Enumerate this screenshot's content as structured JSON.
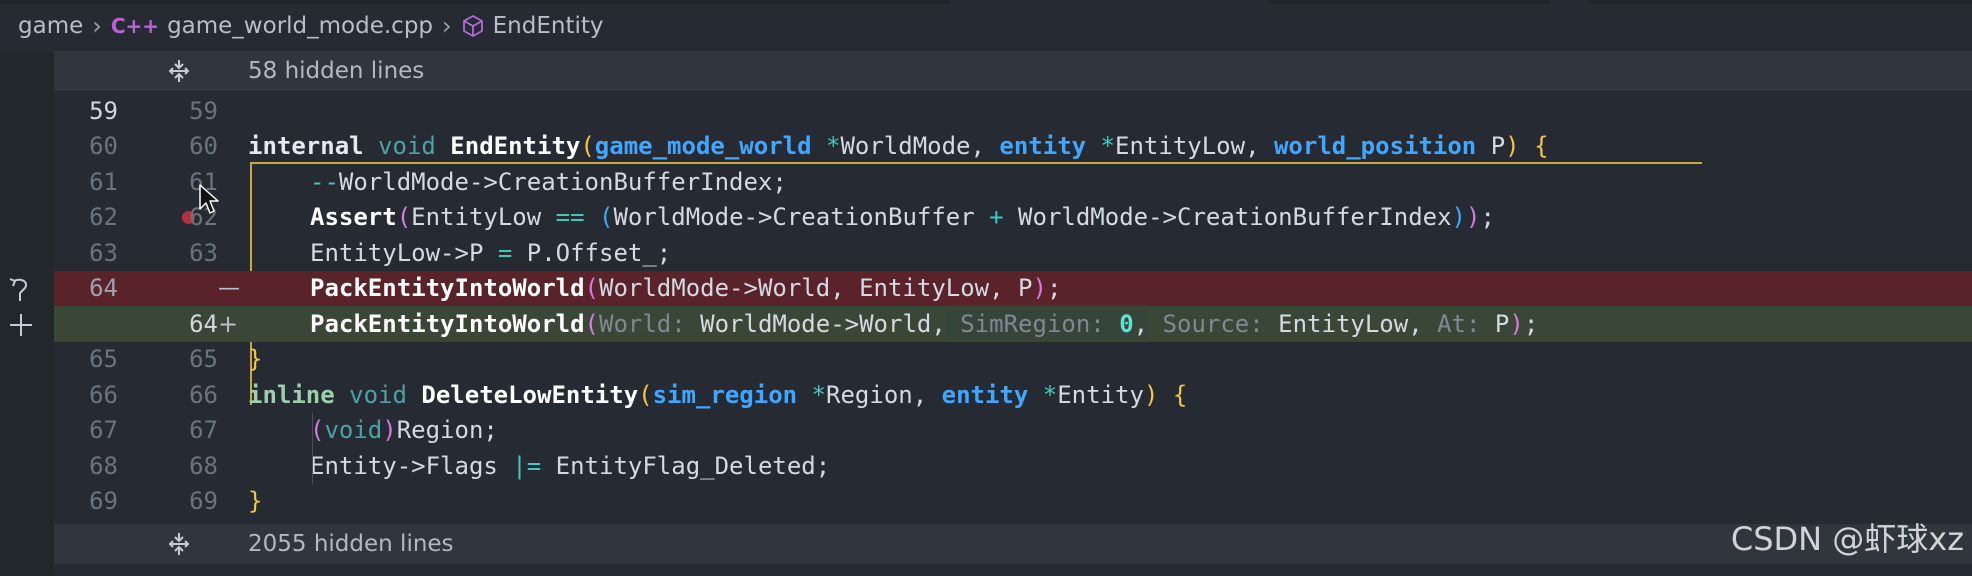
{
  "breadcrumb": {
    "folder": "game",
    "lang_badge": "C++",
    "file": "game_world_mode.cpp",
    "symbol": "EndEntity"
  },
  "folds": {
    "top": "58 hidden lines",
    "bottom": "2055 hidden lines"
  },
  "lines": [
    {
      "old": "59",
      "new": "59"
    },
    {
      "old": "60",
      "new": "60"
    },
    {
      "old": "61",
      "new": "61"
    },
    {
      "old": "62",
      "new": "62"
    },
    {
      "old": "63",
      "new": "63"
    },
    {
      "old": "64",
      "new": ""
    },
    {
      "old": "",
      "new": "64"
    },
    {
      "old": "65",
      "new": "65"
    },
    {
      "old": "66",
      "new": "66"
    },
    {
      "old": "67",
      "new": "67"
    },
    {
      "old": "68",
      "new": "68"
    },
    {
      "old": "69",
      "new": "69"
    }
  ],
  "code": {
    "l60": {
      "internal": "internal",
      "void": "void",
      "fn": "EndEntity",
      "open": "(",
      "t1": "game_mode_world",
      "s1": " *",
      "a1": "WorldMode",
      "c1": ", ",
      "t2": "entity",
      "s2": " *",
      "a2": "EntityLow",
      "c2": ", ",
      "t3": "world_position",
      "a3": " P",
      "close": ")",
      "brace": " {"
    },
    "l61": {
      "op": "--",
      "rest": "WorldMode->CreationBufferIndex;"
    },
    "l62": {
      "fn": "Assert",
      "open": "(",
      "a": "EntityLow ",
      "eq": "==",
      "sp": " ",
      "open2": "(",
      "b": "WorldMode->CreationBuffer ",
      "plus": "+",
      "c": " WorldMode->CreationBufferIndex",
      "close2": ")",
      "close": ")",
      "semi": ";"
    },
    "l63": {
      "a": "EntityLow->P ",
      "eq": "=",
      "b": " P.Offset_;"
    },
    "l64_removed": {
      "fn": "PackEntityIntoWorld",
      "open": "(",
      "args": "WorldMode->World, EntityLow, P",
      "close": ")",
      "semi": ";"
    },
    "l64_added": {
      "fn": "PackEntityIntoWorld",
      "open": "(",
      "h1": "World:",
      "v1": " WorldMode->World,",
      "h2": " SimRegion:",
      "v2": " 0",
      "c2": ",",
      "h3": " Source:",
      "v3": " EntityLow,",
      "h4": " At:",
      "v4": " P",
      "close": ")",
      "semi": ";"
    },
    "l65": {
      "brace": "}"
    },
    "l66": {
      "inline": "inline",
      "void": "void",
      "fn": "DeleteLowEntity",
      "open": "(",
      "t1": "sim_region",
      "s1": " *",
      "a1": "Region",
      "c1": ", ",
      "t2": "entity",
      "s2": " *",
      "a2": "Entity",
      "close": ")",
      "brace": " {"
    },
    "l67": {
      "open": "(",
      "void": "void",
      "close": ")",
      "rest": "Region;"
    },
    "l68": {
      "a": "Entity->Flags ",
      "op": "|=",
      "b": " EntityFlag_Deleted;"
    },
    "l69": {
      "brace": "}"
    }
  },
  "watermark": "CSDN @虾球xz",
  "colors": {
    "background": "#262b33",
    "removed_line": "#5a2229",
    "added_line": "#3b4736",
    "type": "#3fa7ff",
    "operator": "#3ec8c0",
    "bracket_1": "#f4c542",
    "bracket_2": "#d77ae0",
    "breakpoint": "#b8303d"
  },
  "icons": [
    "cpp-file-icon",
    "symbol-cube-icon",
    "unfold-icon",
    "breakpoint-icon",
    "revert-icon",
    "add-icon",
    "mouse-cursor-icon"
  ]
}
